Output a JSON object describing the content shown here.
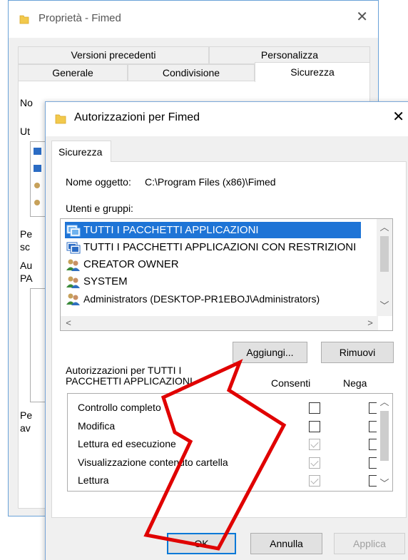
{
  "background_window": {
    "title": "Proprietà - Fimed",
    "close_glyph": "✕",
    "tabs_row1": [
      "Versioni precedenti",
      "Personalizza"
    ],
    "tabs_row2": [
      "Generale",
      "Condivisione",
      "Sicurezza"
    ],
    "partial_labels": [
      "No",
      "Ut",
      "Pe",
      "sc",
      "Au",
      "PA",
      "Pe",
      "av"
    ]
  },
  "dialog": {
    "title": "Autorizzazioni per Fimed",
    "close_glyph": "✕",
    "tab": "Sicurezza",
    "object_name_label": "Nome oggetto:",
    "object_name_value": "C:\\Program Files (x86)\\Fimed",
    "users_label": "Utenti e gruppi:",
    "users": [
      {
        "name": "TUTTI I PACCHETTI APPLICAZIONI",
        "icon": "package-group-icon",
        "selected": true
      },
      {
        "name": "TUTTI I PACCHETTI APPLICAZIONI CON RESTRIZIONI",
        "icon": "package-group-icon",
        "selected": false
      },
      {
        "name": "CREATOR OWNER",
        "icon": "users-group-icon",
        "selected": false
      },
      {
        "name": "SYSTEM",
        "icon": "users-group-icon",
        "selected": false
      },
      {
        "name": "Administrators (DESKTOP-PR1EBOJ\\Administrators)",
        "icon": "users-group-icon",
        "selected": false
      }
    ],
    "add_button": "Aggiungi...",
    "remove_button": "Rimuovi",
    "permissions_label": "Autorizzazioni per TUTTI I PACCHETTI APPLICAZIONI",
    "permissions_label_line1": "Autorizzazioni per TUTTI I",
    "permissions_label_line2": "PACCHETTI APPLICAZIONI",
    "allow_header": "Consenti",
    "deny_header": "Nega",
    "permissions": [
      {
        "name": "Controllo completo",
        "allow": false,
        "allow_inherited": false,
        "deny": false
      },
      {
        "name": "Modifica",
        "allow": false,
        "allow_inherited": false,
        "deny": false
      },
      {
        "name": "Lettura ed esecuzione",
        "allow": true,
        "allow_inherited": true,
        "deny": false
      },
      {
        "name": "Visualizzazione contenuto cartella",
        "allow": true,
        "allow_inherited": true,
        "deny": false
      },
      {
        "name": "Lettura",
        "allow": true,
        "allow_inherited": true,
        "deny": false
      }
    ],
    "ok_button": "OK",
    "cancel_button": "Annulla",
    "apply_button": "Applica"
  },
  "colors": {
    "selection": "#1e74d6",
    "annotation_arrow": "#e00000"
  }
}
